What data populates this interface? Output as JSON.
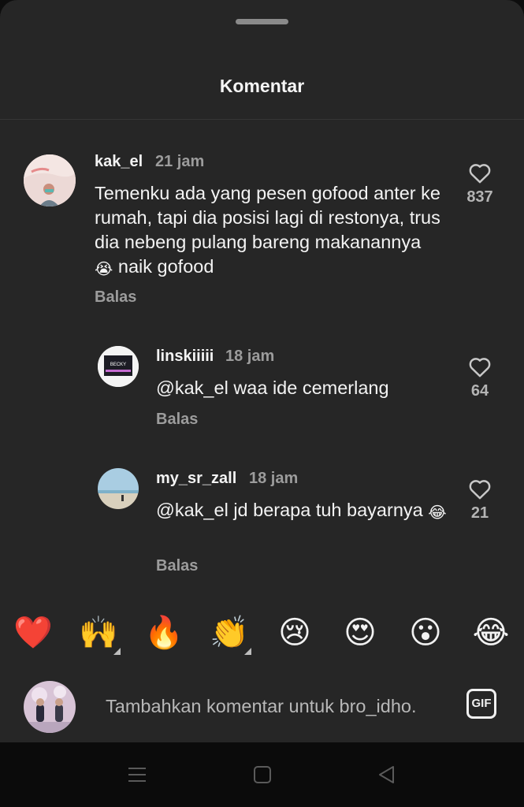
{
  "sheet": {
    "title": "Komentar"
  },
  "comments": [
    {
      "username": "kak_el",
      "time": "21 jam",
      "text": "Temenku ada yang pesen gofood anter ke rumah, tapi dia posisi lagi di restonya, trus dia nebeng pulang bareng makanannya",
      "text_emoji": "😭",
      "text_tail": " naik gofood",
      "reply_label": "Balas",
      "likes": "837"
    },
    {
      "username": "linskiiiii",
      "time": "18 jam",
      "text": "@kak_el waa ide cemerlang",
      "reply_label": "Balas",
      "likes": "64",
      "avatar_text": "BECKY"
    },
    {
      "username": "my_sr_zall",
      "time": "18 jam",
      "text": "@kak_el jd berapa tuh bayarnya",
      "text_emoji": "😂",
      "reply_label": "Balas",
      "likes": "21"
    }
  ],
  "reactions": [
    {
      "emoji": "❤️",
      "name": "red-heart",
      "has_variants": false
    },
    {
      "emoji": "🙌",
      "name": "raising-hands",
      "has_variants": true
    },
    {
      "emoji": "🔥",
      "name": "fire",
      "has_variants": false
    },
    {
      "emoji": "👏",
      "name": "clapping-hands",
      "has_variants": true
    },
    {
      "emoji": "😢",
      "name": "crying-face",
      "has_variants": false
    },
    {
      "emoji": "😍",
      "name": "heart-eyes",
      "has_variants": false
    },
    {
      "emoji": "😮",
      "name": "surprised-face",
      "has_variants": false
    },
    {
      "emoji": "😂",
      "name": "tears-of-joy",
      "has_variants": false
    }
  ],
  "composer": {
    "placeholder": "Tambahkan komentar untuk bro_idho.",
    "gif_label": "GIF"
  },
  "icons": {
    "like": "heart-outline-icon",
    "gif": "gif-icon"
  },
  "colors": {
    "sheet_bg": "#262626",
    "text": "#f3f3f3",
    "muted": "#9c9c9c",
    "nav_bg": "#0b0b0b"
  }
}
